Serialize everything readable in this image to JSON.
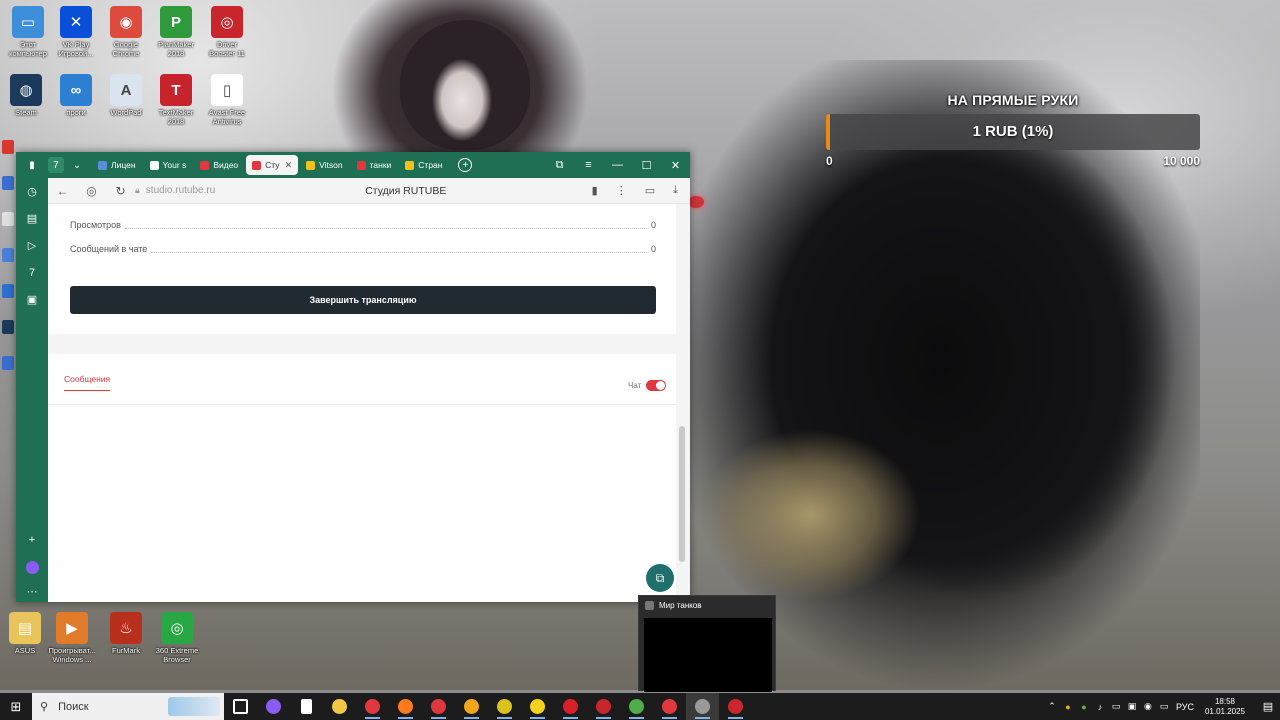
{
  "desktop": {
    "icons_top": [
      {
        "label": "Этот\nкомпьютер",
        "icon": "this-pc-icon",
        "color": "#3d8fd9",
        "glyph": "▭"
      },
      {
        "label": "VK Play\nИгровой...",
        "icon": "vkplay-icon",
        "color": "#0a4fd8",
        "glyph": "✕"
      },
      {
        "label": "Google\nChrome",
        "icon": "chrome-icon",
        "color": "#dd4b3e",
        "glyph": "◉"
      },
      {
        "label": "PlanMaker\n2018",
        "icon": "planmaker-icon",
        "color": "#2e9a3b",
        "glyph": "P"
      },
      {
        "label": "Driver\nBooster 11",
        "icon": "driver-booster-icon",
        "color": "#c7262c",
        "glyph": "◎"
      },
      {
        "label": "Steam",
        "icon": "steam-icon",
        "color": "#1b3a5c",
        "glyph": "◍"
      },
      {
        "label": "проги",
        "icon": "folder-progs-icon",
        "color": "#2c7fd1",
        "glyph": "∞"
      },
      {
        "label": "WordPad",
        "icon": "wordpad-icon",
        "color": "#d9e4ef",
        "glyph": "A"
      },
      {
        "label": "TextMaker\n2018",
        "icon": "textmaker-icon",
        "color": "#c7232b",
        "glyph": "T"
      },
      {
        "label": "Avast Free\nAntivirus",
        "icon": "avast-icon",
        "color": "#ffffff",
        "glyph": "▯"
      }
    ],
    "icons_bottom": [
      {
        "label": "ASUS",
        "icon": "asus-folder-icon",
        "color": "#e8c45a",
        "glyph": "▤"
      },
      {
        "label": "Проигрыват...\nWindows ...",
        "icon": "media-player-icon",
        "color": "#e07b2a",
        "glyph": "▶"
      },
      {
        "label": "FurMark",
        "icon": "furmark-icon",
        "color": "#b8301c",
        "glyph": "♨"
      },
      {
        "label": "360 Extreme\nBrowser",
        "icon": "360-browser-icon",
        "color": "#29a745",
        "glyph": "◎"
      }
    ]
  },
  "donation": {
    "title": "НА ПРЯМЫЕ РУКИ",
    "amount": "1 RUB (1%)",
    "progress_fraction": 0.01,
    "min": "0",
    "max": "10 000",
    "fill_color": "#e88a1a"
  },
  "browser": {
    "tab_count_badge": "7",
    "tabs": [
      {
        "label": "Лицен",
        "color": "#5a8fd8",
        "active": false
      },
      {
        "label": "Your s",
        "color": "#ffffff",
        "active": false
      },
      {
        "label": "Видео",
        "color": "#e0383f",
        "active": false
      },
      {
        "label": "Сту",
        "color": "#e0383f",
        "active": true
      },
      {
        "label": "Vitson",
        "color": "#f2c21b",
        "active": false
      },
      {
        "label": "танки",
        "color": "#e0383f",
        "active": false
      },
      {
        "label": "Стран",
        "color": "#f2c21b",
        "active": false
      }
    ],
    "url": "studio.rutube.ru",
    "page_title": "Студия RUTUBE",
    "stats": [
      {
        "label": "Просмотров",
        "value": "0"
      },
      {
        "label": "Сообщений в чате",
        "value": "0"
      }
    ],
    "end_button": "Завершить трансляцию",
    "messages_tab": "Сообщения",
    "chat_label": "Чат",
    "chat_enabled": true
  },
  "thumbnail_popup": {
    "title": "Мир танков"
  },
  "taskbar": {
    "search_placeholder": "Поиск",
    "apps": [
      {
        "icon": "task-view-icon",
        "color": "#ffffff"
      },
      {
        "icon": "alice-icon",
        "color": "#8a5cf6"
      },
      {
        "icon": "notepad-icon",
        "color": "#ffffff"
      },
      {
        "icon": "explorer-icon",
        "color": "#f2c744"
      },
      {
        "icon": "yandex-icon",
        "color": "#e0383f"
      },
      {
        "icon": "firefox-icon",
        "color": "#ff7a1a"
      },
      {
        "icon": "opera-gx-icon",
        "color": "#e0383f"
      },
      {
        "icon": "media-icon",
        "color": "#f2a71b"
      },
      {
        "icon": "app-yellow-icon",
        "color": "#d8c21b"
      },
      {
        "icon": "yandex-browser-icon",
        "color": "#f2d21b"
      },
      {
        "icon": "opera-icon",
        "color": "#d8202a"
      },
      {
        "icon": "app-red-icon",
        "color": "#c7262c"
      },
      {
        "icon": "chrome-task-icon",
        "color": "#4fae4a"
      },
      {
        "icon": "yandex-browser-active-icon",
        "color": "#e0383f"
      },
      {
        "icon": "tanks-icon",
        "color": "#9a9a9a"
      },
      {
        "icon": "obs-icon",
        "color": "#c7262c"
      }
    ],
    "language": "РУС",
    "time": "18:58",
    "date": "01.01.2025"
  }
}
